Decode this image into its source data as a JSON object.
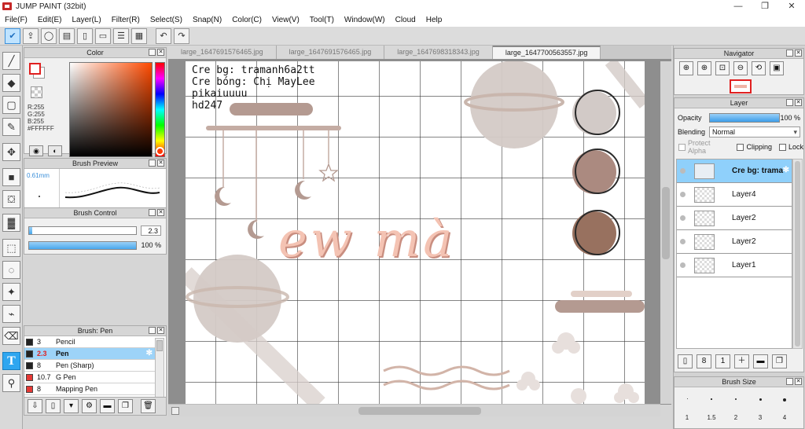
{
  "window": {
    "title": "JUMP PAINT (32bit)",
    "controls": [
      "—",
      "❐",
      "✕"
    ]
  },
  "menu": [
    "File(F)",
    "Edit(E)",
    "Layer(L)",
    "Filter(R)",
    "Select(S)",
    "Snap(N)",
    "Color(C)",
    "View(V)",
    "Tool(T)",
    "Window(W)",
    "Cloud",
    "Help"
  ],
  "toolbar_icons": [
    "check-icon",
    "share-icon",
    "comment-icon",
    "chat-icon",
    "page-icon",
    "pages-icon",
    "list-icon",
    "grid-icon",
    "undo-icon",
    "redo-icon"
  ],
  "tools": [
    "brush",
    "eraser",
    "select-rect",
    "fill-pen",
    "move",
    "fill-rect",
    "bucket",
    "gradient",
    "marquee",
    "lasso",
    "magic-wand",
    "select-pen",
    "select-eraser",
    "text",
    "eyedropper"
  ],
  "color_panel": {
    "title": "Color",
    "r": "R:255",
    "g": "G:255",
    "b": "B:255",
    "hex": "#FFFFFF",
    "primary": "#FFFFFF",
    "secondary": "#FFFFFF"
  },
  "brush_preview": {
    "title": "Brush Preview",
    "size": "0.61mm"
  },
  "brush_control": {
    "title": "Brush Control",
    "size_value": "2.3",
    "opacity_value": "100 %",
    "size_fraction": 0.03,
    "opacity_fraction": 1.0
  },
  "brush_list": {
    "title": "Brush: Pen",
    "items": [
      {
        "size": "3",
        "name": "Pencil",
        "color": "#222222"
      },
      {
        "size": "2.3",
        "name": "Pen",
        "color": "#222222",
        "selected": true
      },
      {
        "size": "8",
        "name": "Pen (Sharp)",
        "color": "#222222"
      },
      {
        "size": "10.7",
        "name": "G Pen",
        "color": "#e53935"
      },
      {
        "size": "8",
        "name": "Mapping Pen",
        "color": "#e53935"
      }
    ]
  },
  "tabs": [
    "large_1647691576465.jpg",
    "large_1647691576465.jpg",
    "large_1647698318343.jpg",
    "large_1647700563557.jpg"
  ],
  "active_tab": 3,
  "canvas": {
    "credits": [
      "Cre bg: tramanh6a2tt",
      "Cre bóng: Chị MayLee",
      "pikaiuuuu",
      "hd247"
    ],
    "word": "ew mà"
  },
  "navigator": {
    "title": "Navigator"
  },
  "layer_panel": {
    "title": "Layer",
    "opacity_label": "Opacity",
    "opacity_value": "100 %",
    "blending_label": "Blending",
    "blending_value": "Normal",
    "protect_alpha": "Protect Alpha",
    "clipping": "Clipping",
    "lock": "Lock",
    "layers": [
      {
        "name": "Cre bg: trama",
        "selected": true
      },
      {
        "name": "Layer4"
      },
      {
        "name": "Layer2"
      },
      {
        "name": "Layer2"
      },
      {
        "name": "Layer1"
      }
    ]
  },
  "brush_size": {
    "title": "Brush Size",
    "sizes": [
      "1",
      "1.5",
      "2",
      "3",
      "4"
    ]
  }
}
